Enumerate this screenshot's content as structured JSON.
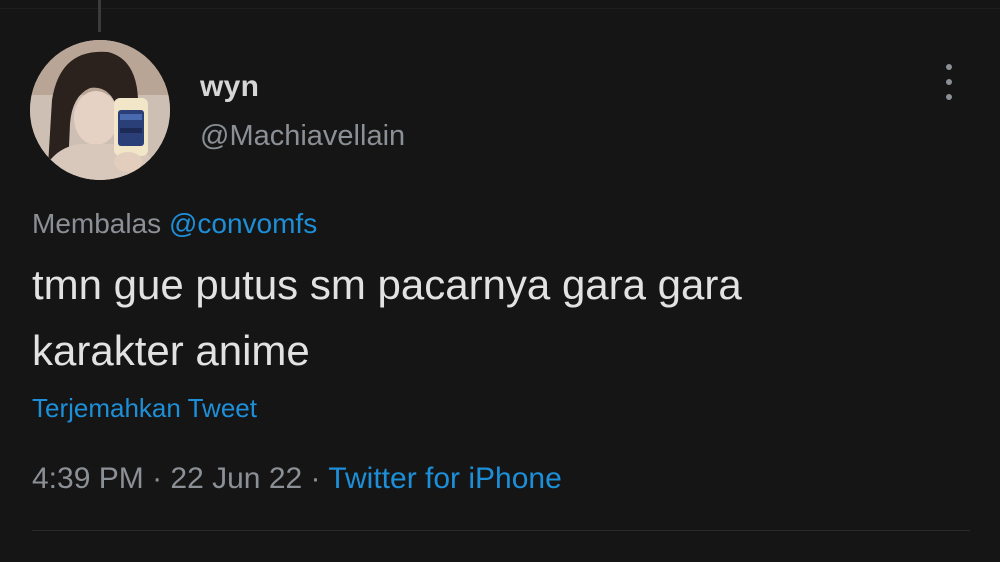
{
  "tweet": {
    "author": {
      "display_name": "wyn",
      "handle": "@Machiavellain",
      "avatar_icon": "profile-photo"
    },
    "reply": {
      "prefix": "Membalas",
      "mention": "@convomfs"
    },
    "text_line1": "tmn gue putus sm pacarnya gara gara",
    "text_line2": "karakter anime",
    "translate_label": "Terjemahkan Tweet",
    "time": "4:39 PM",
    "separator": "·",
    "date": "22 Jun 22",
    "source": "Twitter for iPhone"
  },
  "colors": {
    "background": "#151515",
    "link": "#1d8fd8",
    "muted": "#8b9096",
    "text": "#e2e2e2"
  }
}
